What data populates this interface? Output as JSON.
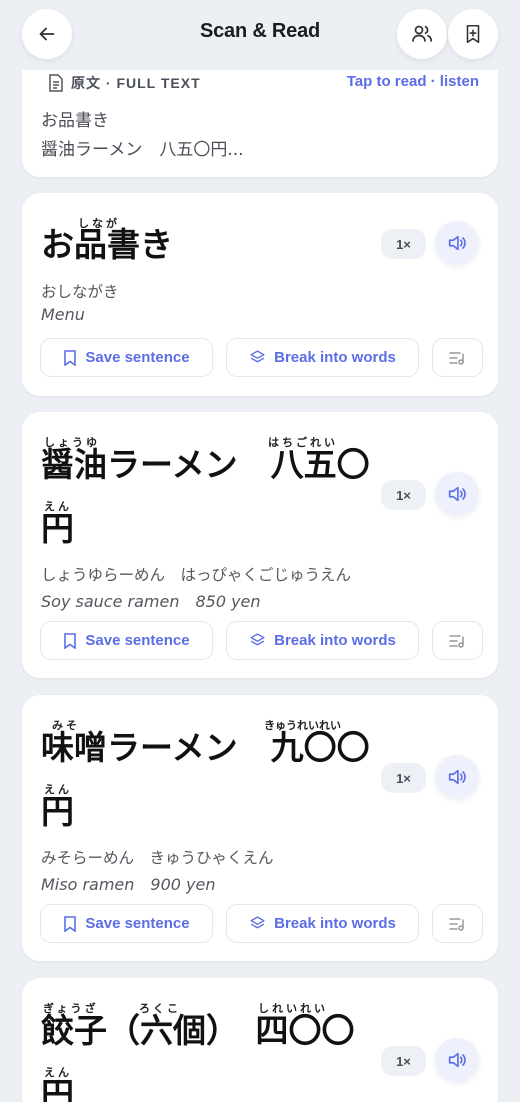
{
  "header": {
    "title": "Scan & Read",
    "back_icon": "arrow-left-icon",
    "people_icon": "users-icon",
    "bookmark_icon": "bookmark-add-icon"
  },
  "full_text": {
    "label": "原文 · FULL TEXT",
    "link": "Tap to read · listen",
    "lines": [
      "お品書き",
      "醤油ラーメン　八五〇円..."
    ]
  },
  "actions": {
    "save": "Save sentence",
    "break": "Break into words",
    "speed": "1×"
  },
  "sentences": [
    {
      "japanese": "お品書き",
      "ruby": [
        {
          "text": "しなが"
        }
      ],
      "reading": "おしながき",
      "translation": "Menu"
    },
    {
      "japanese_line1": "醤油ラーメン　八五〇",
      "japanese_line2": "円",
      "ruby": [
        {
          "text": "しょうゆ"
        },
        {
          "text": "はちごれい"
        },
        {
          "text": "えん"
        }
      ],
      "reading": "しょうゆらーめん　はっぴゃくごじゅうえん",
      "translation": "Soy sauce ramen　850 yen"
    },
    {
      "japanese_line1": "味噌ラーメン　九〇〇",
      "japanese_line2": "円",
      "ruby": [
        {
          "text": "みそ"
        },
        {
          "text": "きゅうれいれい"
        },
        {
          "text": "えん"
        }
      ],
      "reading": "みそらーめん　きゅうひゃくえん",
      "translation": "Miso ramen　900 yen"
    },
    {
      "japanese_line1": "餃子（六個）　四〇〇",
      "japanese_line2": "円",
      "ruby": [
        {
          "text": "ぎょうざ"
        },
        {
          "text": "ろくこ"
        },
        {
          "text": "しれいれい"
        },
        {
          "text": "えん"
        }
      ]
    }
  ],
  "colors": {
    "accent": "#5b6ee6",
    "background": "#eceff4",
    "card": "#ffffff"
  }
}
